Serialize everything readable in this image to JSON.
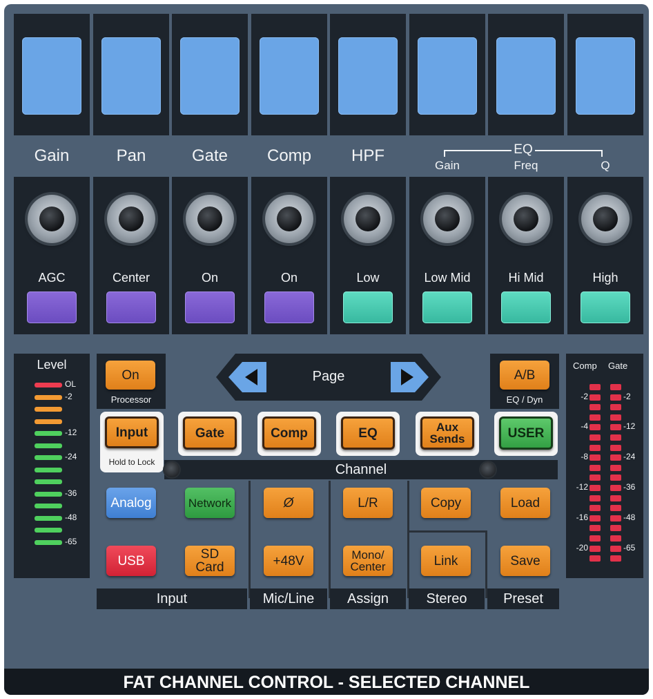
{
  "strips": [
    {
      "header": "Gain",
      "label": "AGC",
      "pad": "purple"
    },
    {
      "header": "Pan",
      "label": "Center",
      "pad": "purple"
    },
    {
      "header": "Gate",
      "label": "On",
      "pad": "purple"
    },
    {
      "header": "Comp",
      "label": "On",
      "pad": "purple"
    },
    {
      "header": "HPF",
      "label": "Low",
      "pad": "teal"
    },
    {
      "header": "Gain",
      "label": "Low Mid",
      "pad": "teal"
    },
    {
      "header": "Freq",
      "label": "Hi Mid",
      "pad": "teal"
    },
    {
      "header": "Q",
      "label": "High",
      "pad": "teal"
    }
  ],
  "eq_group_label": "EQ",
  "level_meter": {
    "title": "Level",
    "labels": [
      "OL",
      "-2",
      "-12",
      "-24",
      "-36",
      "-48",
      "-65"
    ]
  },
  "processor": {
    "button": "On",
    "caption": "Processor"
  },
  "page": {
    "label": "Page"
  },
  "ab": {
    "button": "A/B",
    "caption": "EQ / Dyn"
  },
  "modes": {
    "input": "Input",
    "gate": "Gate",
    "comp": "Comp",
    "eq": "EQ",
    "aux_line1": "Aux",
    "aux_line2": "Sends",
    "user": "USER",
    "hold_to_lock": "Hold to Lock"
  },
  "channel_label": "Channel",
  "input_section": {
    "analog": "Analog",
    "network": "Network",
    "usb": "USB",
    "sdcard": "SD Card",
    "label": "Input"
  },
  "micline_section": {
    "phase": "Ø",
    "phantom": "+48V",
    "label": "Mic/Line"
  },
  "assign_section": {
    "lr": "L/R",
    "mono_line1": "Mono/",
    "mono_line2": "Center",
    "label": "Assign"
  },
  "stereo_section": {
    "copy": "Copy",
    "link": "Link",
    "label": "Stereo"
  },
  "preset_section": {
    "load": "Load",
    "save": "Save",
    "label": "Preset"
  },
  "gr_meter": {
    "comp_title": "Comp",
    "gate_title": "Gate",
    "comp_labels": [
      "-2",
      "-4",
      "-8",
      "-12",
      "-16",
      "-20"
    ],
    "gate_labels": [
      "-2",
      "-12",
      "-24",
      "-36",
      "-48",
      "-65"
    ]
  },
  "footer_title": "FAT CHANNEL CONTROL - SELECTED CHANNEL",
  "colors": {
    "panel": "#4d5f73",
    "strip": "#1d242c",
    "screen": "#6aa5e6",
    "orange": "#f39a33",
    "purple_pad": "#7a5ccc",
    "teal_pad": "#4bcab0",
    "meter_green": "#4fd05e",
    "meter_red": "#ee3c50"
  }
}
